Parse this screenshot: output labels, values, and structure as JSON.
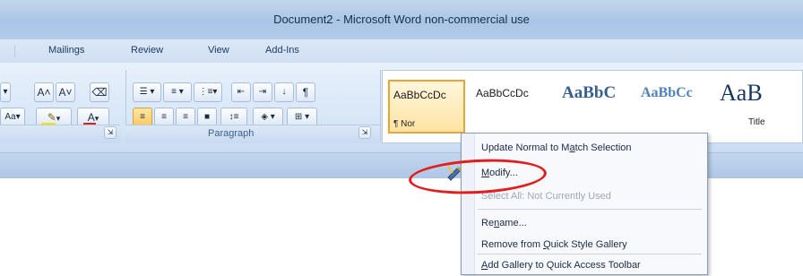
{
  "window": {
    "title": "Document2 - Microsoft Word non-commercial use"
  },
  "tabs": [
    {
      "label": "Mailings"
    },
    {
      "label": "Review"
    },
    {
      "label": "View"
    },
    {
      "label": "Add-Ins"
    }
  ],
  "font_group": {
    "grow_label": "A˄",
    "shrink_label": "A˅",
    "change_case_label": "Aa▾",
    "font_color_label": "A"
  },
  "paragraph_group": {
    "label": "Paragraph",
    "sort_label": "↓",
    "pilcrow": "¶"
  },
  "styles_gallery": {
    "tiles": [
      {
        "sample": "AaBbCcDc",
        "name": "¶ Nor"
      },
      {
        "sample": "AaBbCcDc",
        "name": ""
      },
      {
        "sample": "AaBbC",
        "name": ""
      },
      {
        "sample": "AaBbCc",
        "name": ""
      },
      {
        "sample": "AaB",
        "name": "Title"
      }
    ]
  },
  "context_menu": {
    "update_pre": "Update Normal to M",
    "update_u": "a",
    "update_post": "tch Selection",
    "modify_u": "M",
    "modify_post": "odify...",
    "select_all": "Select All: Not Currently Used",
    "rename_pre": "Re",
    "rename_u": "n",
    "rename_post": "ame...",
    "remove_pre": "Remove from ",
    "remove_u": "Q",
    "remove_post": "uick Style Gallery",
    "add_u": "A",
    "add_post": "dd Gallery to Quick Access Toolbar"
  },
  "colors": {
    "highlight_oval": "#e21d1d",
    "font_color_bar": "#e02020",
    "highlighter_bar": "#f5e20a"
  }
}
